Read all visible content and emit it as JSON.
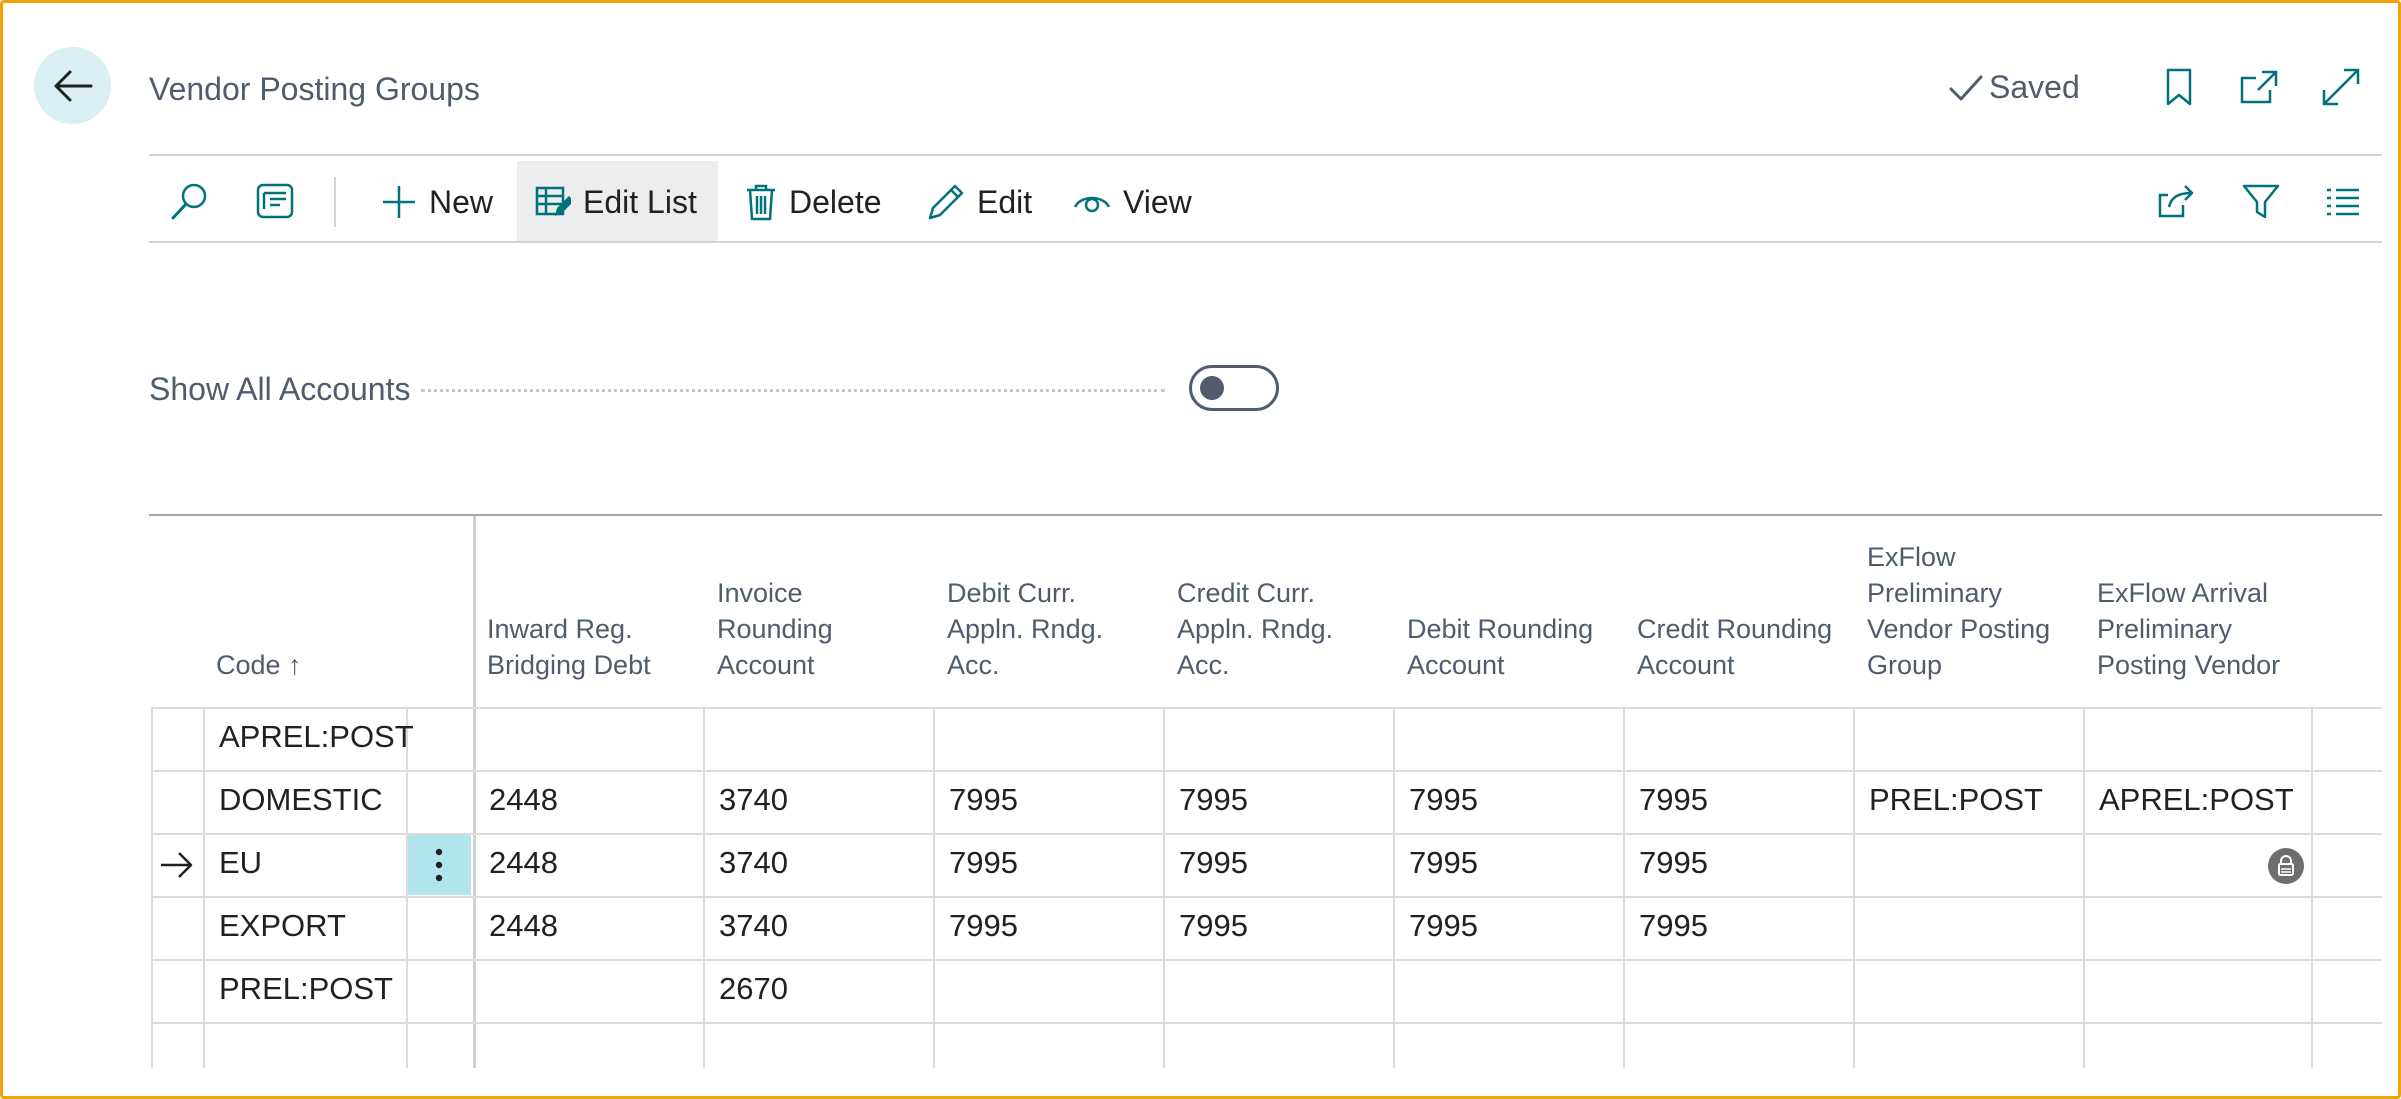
{
  "header": {
    "title": "Vendor Posting Groups",
    "saved_label": "Saved"
  },
  "toolbar": {
    "new_label": "New",
    "edit_list_label": "Edit List",
    "delete_label": "Delete",
    "edit_label": "Edit",
    "view_label": "View"
  },
  "filter": {
    "show_all_label": "Show All Accounts",
    "show_all_value": false
  },
  "table": {
    "columns": [
      "Code ↑",
      "Inward Reg. Bridging Debt",
      "Invoice Rounding Account",
      "Debit Curr. Appln. Rndg. Acc.",
      "Credit Curr. Appln. Rndg. Acc.",
      "Debit Rounding Account",
      "Credit Rounding Account",
      "ExFlow Preliminary Vendor Posting Group",
      "ExFlow Arrival Preliminary Posting Vendor"
    ],
    "rows": [
      [
        "APREL:POST",
        "",
        "",
        "",
        "",
        "",
        "",
        "",
        ""
      ],
      [
        "DOMESTIC",
        "2448",
        "3740",
        "7995",
        "7995",
        "7995",
        "7995",
        "PREL:POST",
        "APREL:POST"
      ],
      [
        "EU",
        "2448",
        "3740",
        "7995",
        "7995",
        "7995",
        "7995",
        "",
        ""
      ],
      [
        "EXPORT",
        "2448",
        "3740",
        "7995",
        "7995",
        "7995",
        "7995",
        "",
        ""
      ],
      [
        "PREL:POST",
        "",
        "2670",
        "",
        "",
        "",
        "",
        "",
        ""
      ]
    ],
    "selected_row": 2
  },
  "colors": {
    "accent": "#00727b",
    "frame": "#f0a30a",
    "row_menu_bg": "#b1e5ec"
  }
}
